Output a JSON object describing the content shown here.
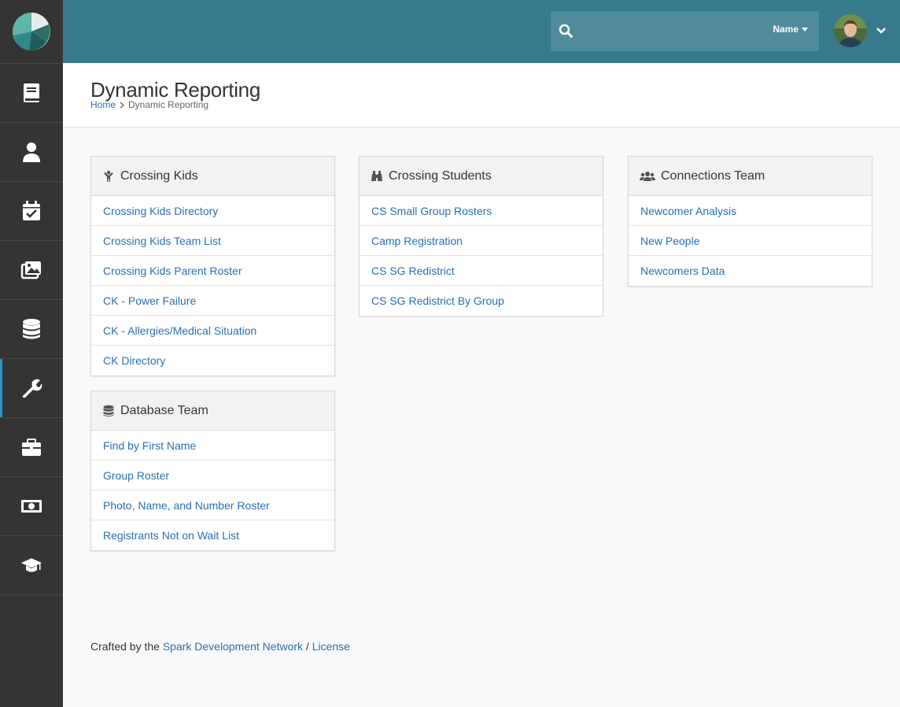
{
  "colors": {
    "topbar": "#367a8c",
    "sidebar": "#343434",
    "link": "#2a6fb2",
    "active_indicator": "#2c93c6"
  },
  "sidebar": {
    "logo_icon": "rock-logo-icon",
    "items": [
      {
        "icon": "book-icon",
        "active": false
      },
      {
        "icon": "user-icon",
        "active": false
      },
      {
        "icon": "calendar-check-icon",
        "active": false
      },
      {
        "icon": "images-icon",
        "active": false
      },
      {
        "icon": "database-icon",
        "active": false
      },
      {
        "icon": "wrench-icon",
        "active": true
      },
      {
        "icon": "briefcase-icon",
        "active": false
      },
      {
        "icon": "money-bill-icon",
        "active": false
      },
      {
        "icon": "graduation-cap-icon",
        "active": false
      }
    ]
  },
  "topbar": {
    "search_value": "",
    "search_filter_label": "Name"
  },
  "header": {
    "title": "Dynamic Reporting",
    "breadcrumb": {
      "home": "Home",
      "current": "Dynamic Reporting"
    }
  },
  "panels": [
    {
      "title": "Crossing Kids",
      "icon": "child-icon",
      "links": [
        "Crossing Kids Directory",
        "Crossing Kids Team List",
        "Crossing Kids Parent Roster",
        "CK - Power Failure",
        "CK - Allergies/Medical Situation",
        "CK Directory"
      ]
    },
    {
      "title": "Crossing Students",
      "icon": "binoculars-icon",
      "links": [
        "CS Small Group Rosters",
        "Camp Registration",
        "CS SG Redistrict",
        "CS SG Redistrict By Group"
      ]
    },
    {
      "title": "Connections Team",
      "icon": "users-icon",
      "links": [
        "Newcomer Analysis",
        "New People",
        "Newcomers Data"
      ]
    },
    {
      "title": "Database Team",
      "icon": "database-icon",
      "links": [
        "Find by First Name",
        "Group Roster",
        "Photo, Name, and Number Roster",
        "Registrants Not on Wait List"
      ]
    }
  ],
  "footer": {
    "prefix": "Crafted by the",
    "link1": "Spark Development Network",
    "separator": "/",
    "link2": "License"
  }
}
